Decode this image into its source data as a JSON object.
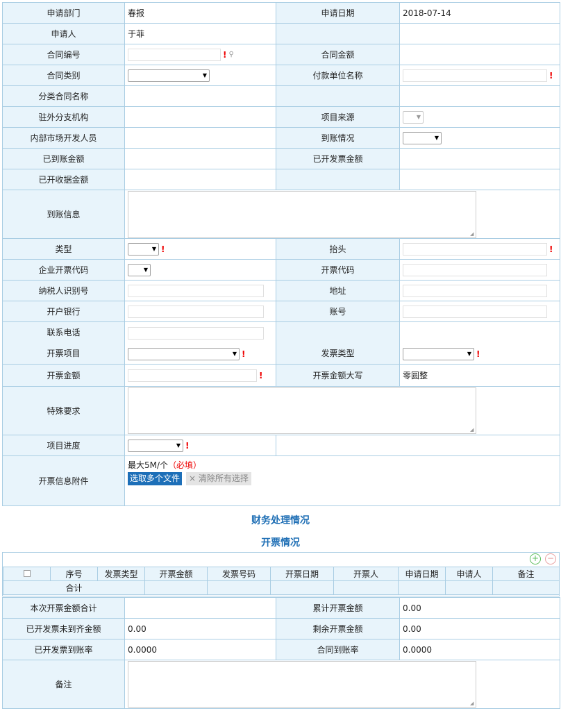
{
  "form": {
    "dept_label": "申请部门",
    "dept_value": "春报",
    "date_label": "申请日期",
    "date_value": "2018-07-14",
    "applicant_label": "申请人",
    "applicant_value": "于菲",
    "contract_no_label": "合同编号",
    "contract_amount_label": "合同金额",
    "contract_type_label": "合同类别",
    "payer_label": "付款单位名称",
    "category_name_label": "分类合同名称",
    "branch_label": "驻外分支机构",
    "project_source_label": "项目来源",
    "market_dev_label": "内部市场开发人员",
    "arrival_status_label": "到账情况",
    "arrived_amount_label": "已到账金额",
    "invoiced_amount_label": "已开发票金额",
    "receipt_amount_label": "已开收据金额",
    "arrival_info_label": "到账信息",
    "type_label": "类型",
    "header_label": "抬头",
    "agent_label": "企业开票代码",
    "agent_code_label": "开票代码",
    "taxpayer_label": "纳税人识别号",
    "address_label": "地址",
    "bank_label": "开户银行",
    "account_label": "账号",
    "phone_label": "联系电话",
    "invoice_item_label": "开票项目",
    "invoice_type_label": "发票类型",
    "invoice_amount_label": "开票金额",
    "amount_upper_label": "开票金额大写",
    "amount_upper_value": "零圆整",
    "special_label": "特殊要求",
    "progress_label": "项目进度",
    "attach_label": "开票信息附件",
    "attach_hint": "最大5M/个",
    "attach_required": "（必填）",
    "upload_button": "选取多个文件",
    "clear_button": "清除所有选择",
    "required_mark": "!"
  },
  "finance_title": "财务处理情况",
  "invoice_title": "开票情况",
  "grid": {
    "add_icon": "plus-circle-icon",
    "remove_icon": "minus-circle-icon",
    "columns": [
      "序号",
      "发票类型",
      "开票金额",
      "发票号码",
      "开票日期",
      "开票人",
      "申请日期",
      "申请人",
      "备注"
    ],
    "total_label": "合计"
  },
  "summary": {
    "this_total_label": "本次开票金额合计",
    "cum_total_label": "累计开票金额",
    "cum_total_value": "0.00",
    "unpaid_label": "已开发票未到齐金额",
    "unpaid_value": "0.00",
    "remain_label": "剩余开票金额",
    "remain_value": "0.00",
    "rate_label": "已开发票到账率",
    "rate_value": "0.0000",
    "contract_rate_label": "合同到账率",
    "contract_rate_value": "0.0000",
    "remark_label": "备注"
  },
  "colors": {
    "label_bg": "#e8f4fb",
    "border": "#a9cde3",
    "accent": "#1f6fb5",
    "required": "#ee0000"
  }
}
